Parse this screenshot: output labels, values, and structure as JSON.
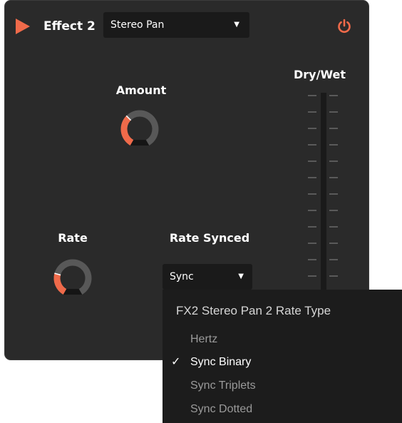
{
  "header": {
    "title": "Effect 2",
    "effect_type": "Stereo Pan",
    "play_icon": "play-triangle-icon",
    "power_icon": "power-icon"
  },
  "knobs": {
    "amount": {
      "label": "Amount",
      "value": 0.35
    },
    "rate": {
      "label": "Rate",
      "value": 0.25
    }
  },
  "rate_synced": {
    "label": "Rate Synced",
    "value": "Sync"
  },
  "dry_wet": {
    "label": "Dry/Wet"
  },
  "dropdown": {
    "title": "FX2 Stereo Pan 2 Rate Type",
    "options": [
      {
        "label": "Hertz",
        "selected": false
      },
      {
        "label": "Sync Binary",
        "selected": true,
        "check": "✓"
      },
      {
        "label": "Sync Triplets",
        "selected": false
      },
      {
        "label": "Sync Dotted",
        "selected": false
      }
    ]
  },
  "colors": {
    "accent": "#ef6a4a",
    "panel": "#2a2a2a",
    "field": "#1a1a1a",
    "menu": "#1c1c1c"
  }
}
